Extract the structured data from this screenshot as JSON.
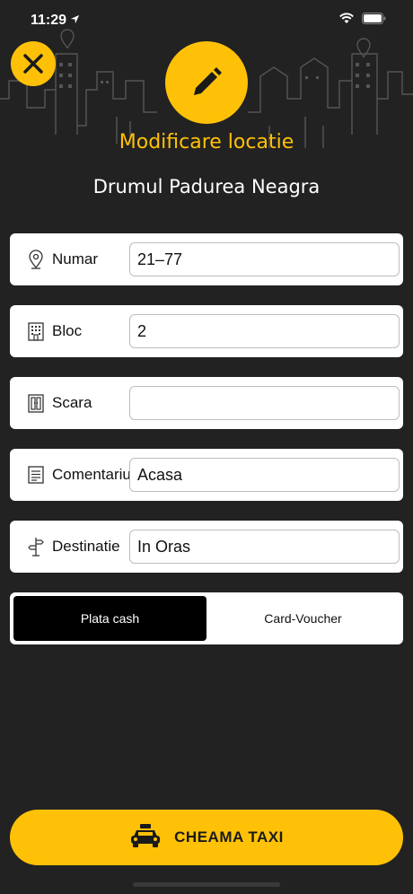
{
  "status_bar": {
    "time": "11:29"
  },
  "header": {
    "title": "Modificare locatie",
    "address": "Drumul Padurea Neagra"
  },
  "colors": {
    "accent": "#ffc107",
    "background": "#222222"
  },
  "fields": [
    {
      "icon": "map-pin-icon",
      "label": "Numar",
      "value": "21–77",
      "placeholder": ""
    },
    {
      "icon": "building-icon",
      "label": "Bloc",
      "value": "2",
      "placeholder": ""
    },
    {
      "icon": "door-icon",
      "label": "Scara",
      "value": "",
      "placeholder": ""
    },
    {
      "icon": "note-icon",
      "label": "Comentariu",
      "value": "Acasa",
      "placeholder": ""
    },
    {
      "icon": "signpost-icon",
      "label": "Destinatie",
      "value": "In Oras",
      "placeholder": ""
    }
  ],
  "payment": {
    "options": [
      "Plata cash",
      "Card-Voucher"
    ],
    "selected": "Plata cash"
  },
  "call_button": {
    "label": "CHEAMA TAXI",
    "icon": "taxi-icon"
  }
}
